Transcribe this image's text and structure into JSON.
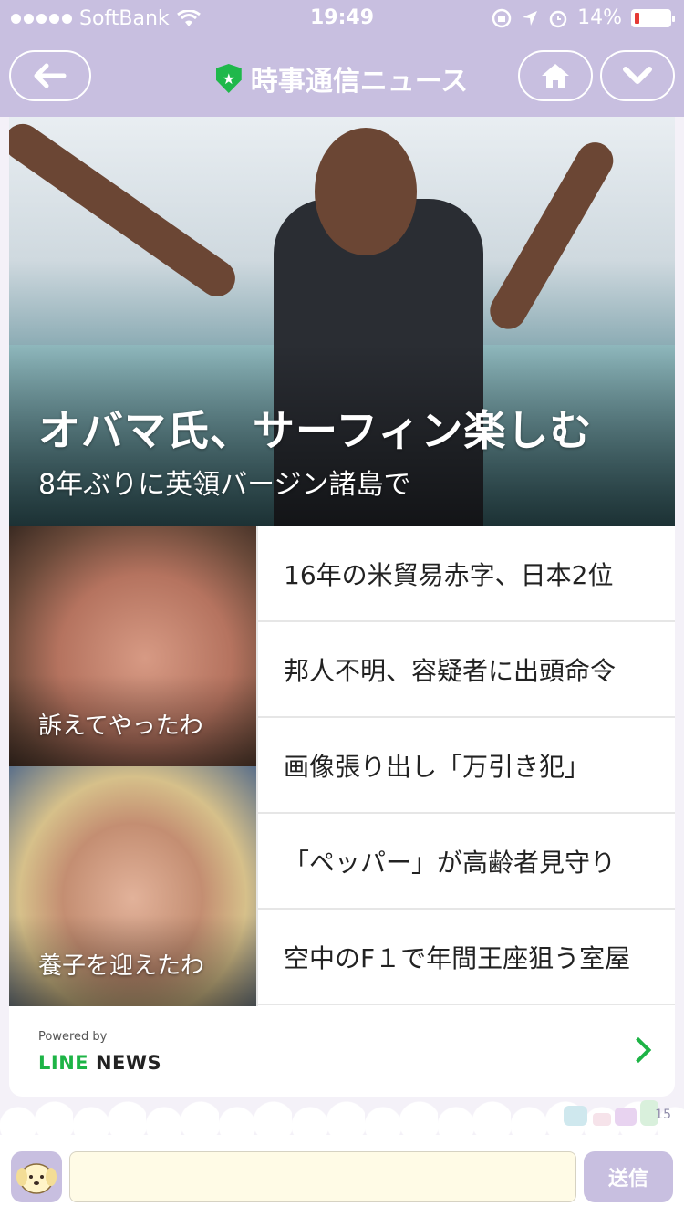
{
  "status_bar": {
    "carrier": "SoftBank",
    "time": "19:49",
    "battery_percent": "14%",
    "battery_level": 0.14
  },
  "navbar": {
    "title": "時事通信ニュース",
    "back_icon": "arrow-left-icon",
    "home_icon": "home-icon",
    "menu_icon": "chevron-down-icon"
  },
  "hero": {
    "title": "オバマ氏、サーフィン楽しむ",
    "subtitle": "8年ぶりに英領バージン諸島で"
  },
  "thumbs": [
    {
      "caption": "訴えてやったわ"
    },
    {
      "caption": "養子を迎えたわ"
    }
  ],
  "headlines": [
    "16年の米貿易赤字、日本2位",
    "邦人不明、容疑者に出頭命令",
    "画像張り出し「万引き犯」",
    "「ペッパー」が高齢者見守り",
    "空中のF１で年間王座狙う室屋"
  ],
  "footer": {
    "powered_by": "Powered by",
    "brand_line": "LINE",
    "brand_news": "NEWS"
  },
  "sticker_count": "15",
  "input": {
    "value": "",
    "send_label": "送信"
  },
  "colors": {
    "theme": "#c8bfe0",
    "line_green": "#1db446",
    "input_bg": "#fffbe6"
  }
}
